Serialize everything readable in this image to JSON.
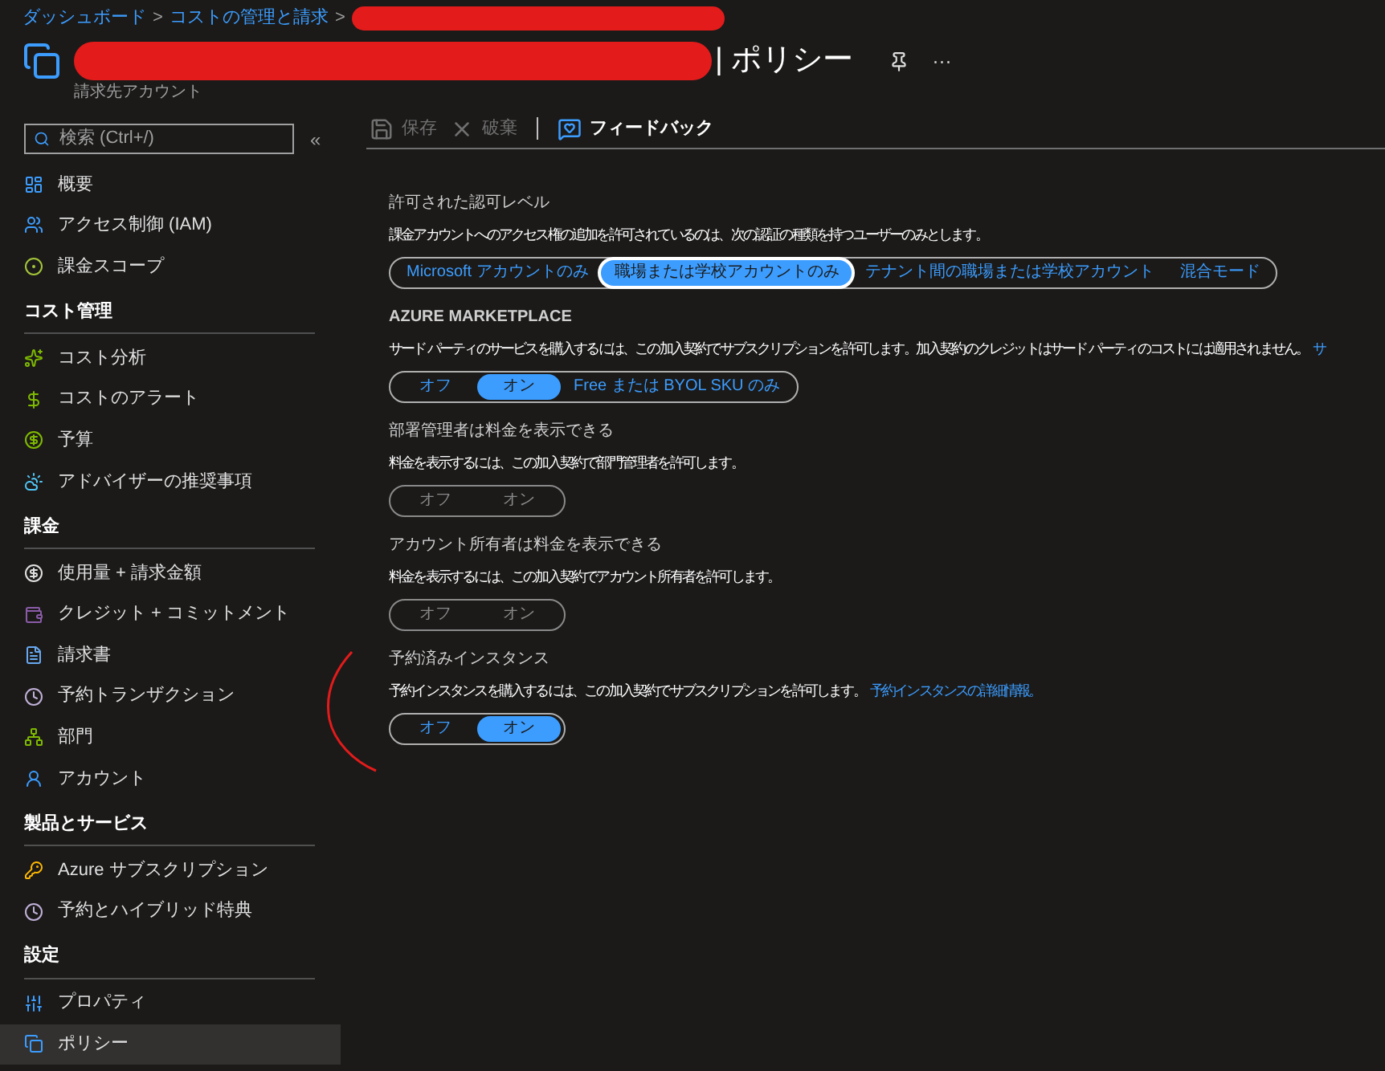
{
  "breadcrumb": [
    {
      "label": "ダッシュボード",
      "separator": ">"
    },
    {
      "label": "コストの管理と請求",
      "separator": ">"
    }
  ],
  "header": {
    "title": "| ポリシー",
    "subtitle": "請求先アカウント",
    "more": "···"
  },
  "sidebar": {
    "search": {
      "placeholder": "検索 (Ctrl+/)"
    },
    "collapse": "«",
    "groups": [
      {
        "items": [
          {
            "label": "概要",
            "selected": false
          },
          {
            "label": "アクセス制御 (IAM)",
            "selected": false
          },
          {
            "label": "課金スコープ",
            "selected": false
          }
        ]
      },
      {
        "heading": "コスト管理",
        "items": [
          {
            "label": "コスト分析",
            "selected": false
          },
          {
            "label": "コストのアラート",
            "selected": false
          },
          {
            "label": "予算",
            "selected": false
          },
          {
            "label": "アドバイザーの推奨事項",
            "selected": false
          }
        ]
      },
      {
        "heading": "課金",
        "items": [
          {
            "label": "使用量 + 請求金額",
            "selected": false
          },
          {
            "label": "クレジット + コミットメント",
            "selected": false
          },
          {
            "label": "請求書",
            "selected": false
          },
          {
            "label": "予約トランザクション",
            "selected": false
          },
          {
            "label": "部門",
            "selected": false
          },
          {
            "label": "アカウント",
            "selected": false
          }
        ]
      },
      {
        "heading": "製品とサービス",
        "items": [
          {
            "label": "Azure サブスクリプション",
            "selected": false
          },
          {
            "label": "予約とハイブリッド特典",
            "selected": false
          }
        ]
      },
      {
        "heading": "設定",
        "items": [
          {
            "label": "プロパティ",
            "selected": false
          },
          {
            "label": "ポリシー",
            "selected": true
          }
        ]
      }
    ]
  },
  "toolbar": [
    {
      "label": "保存",
      "disabled": true
    },
    {
      "label": "破棄",
      "disabled": true
    },
    {
      "label": "フィードバック",
      "disabled": false
    }
  ],
  "sections": [
    {
      "title": "許可された認可レベル",
      "description": "課金アカウントへのアクセス権の追加を許可されているのは、次の認証の種類を持つユーザーのみとします。",
      "disabled": false,
      "options": [
        {
          "label": "Microsoft アカウントのみ",
          "selected": false,
          "focused": false
        },
        {
          "label": "職場または学校アカウントのみ",
          "selected": true,
          "focused": true
        },
        {
          "label": "テナント間の職場または学校アカウント",
          "selected": false,
          "focused": false
        },
        {
          "label": "混合モード",
          "selected": false,
          "focused": false
        }
      ]
    },
    {
      "title": "AZURE MARKETPLACE",
      "description": "サード パーティのサービスを購入するには、この加入契約でサブスクリプションを許可します。加入契約のクレジットはサード パーティのコストには適用されません。",
      "link": "サ",
      "disabled": false,
      "options": [
        {
          "label": "オフ",
          "selected": false,
          "focused": false
        },
        {
          "label": "オン",
          "selected": true,
          "focused": false
        },
        {
          "label": "Free または BYOL SKU のみ",
          "selected": false,
          "focused": false
        }
      ]
    },
    {
      "title": "部署管理者は料金を表示できる",
      "description": "料金を表示するには、この加入契約で部門管理者を許可します。",
      "disabled": true,
      "options": [
        {
          "label": "オフ",
          "selected": false,
          "focused": false
        },
        {
          "label": "オン",
          "selected": false,
          "focused": false
        }
      ]
    },
    {
      "title": "アカウント所有者は料金を表示できる",
      "description": "料金を表示するには、この加入契約でアカウント所有者を許可します。",
      "disabled": true,
      "options": [
        {
          "label": "オフ",
          "selected": false,
          "focused": false
        },
        {
          "label": "オン",
          "selected": false,
          "focused": false
        }
      ]
    },
    {
      "title": "予約済みインスタンス",
      "description": "予約インスタンスを購入するには、この加入契約でサブスクリプションを許可します。",
      "link": "予約インスタンスの詳細情報。",
      "disabled": false,
      "options": [
        {
          "label": "オフ",
          "selected": false,
          "focused": false
        },
        {
          "label": "オン",
          "selected": true,
          "focused": false
        }
      ]
    }
  ]
}
